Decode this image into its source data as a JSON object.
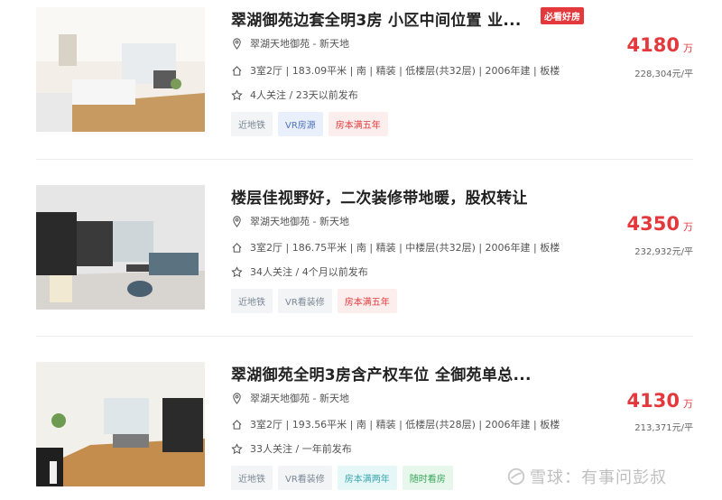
{
  "listings": [
    {
      "title": "翠湖御苑边套全明3房 小区中间位置 业...",
      "badge": "必看好房",
      "community": "翠湖天地御苑 - 新天地",
      "details": "3室2厅 | 183.09平米 | 南 | 精装 | 低楼层(共32层) | 2006年建 | 板楼",
      "follow": "4人关注 / 23天以前发布",
      "price": "4180",
      "price_unit": "万",
      "unit_price": "228,304元/平",
      "tags": [
        "近地铁",
        "VR房源",
        "房本满五年"
      ]
    },
    {
      "title": "楼层佳视野好，二次装修带地暖，股权转让",
      "community": "翠湖天地御苑 - 新天地",
      "details": "3室2厅 | 186.75平米 | 南 | 精装 | 中楼层(共32层) | 2006年建 | 板楼",
      "follow": "34人关注 / 4个月以前发布",
      "price": "4350",
      "price_unit": "万",
      "unit_price": "232,932元/平",
      "tags": [
        "近地铁",
        "VR看装修",
        "房本满五年"
      ]
    },
    {
      "title": "翠湖御苑全明3房含产权车位 全御苑单总...",
      "community": "翠湖天地御苑 - 新天地",
      "details": "3室2厅 | 193.56平米 | 南 | 精装 | 低楼层(共28层) | 2006年建 | 板楼",
      "follow": "33人关注 / 一年前发布",
      "price": "4130",
      "price_unit": "万",
      "unit_price": "213,371元/平",
      "tags": [
        "近地铁",
        "VR看装修",
        "房本满两年",
        "随时看房"
      ]
    }
  ],
  "watermark": "雪球：有事问彭叔"
}
